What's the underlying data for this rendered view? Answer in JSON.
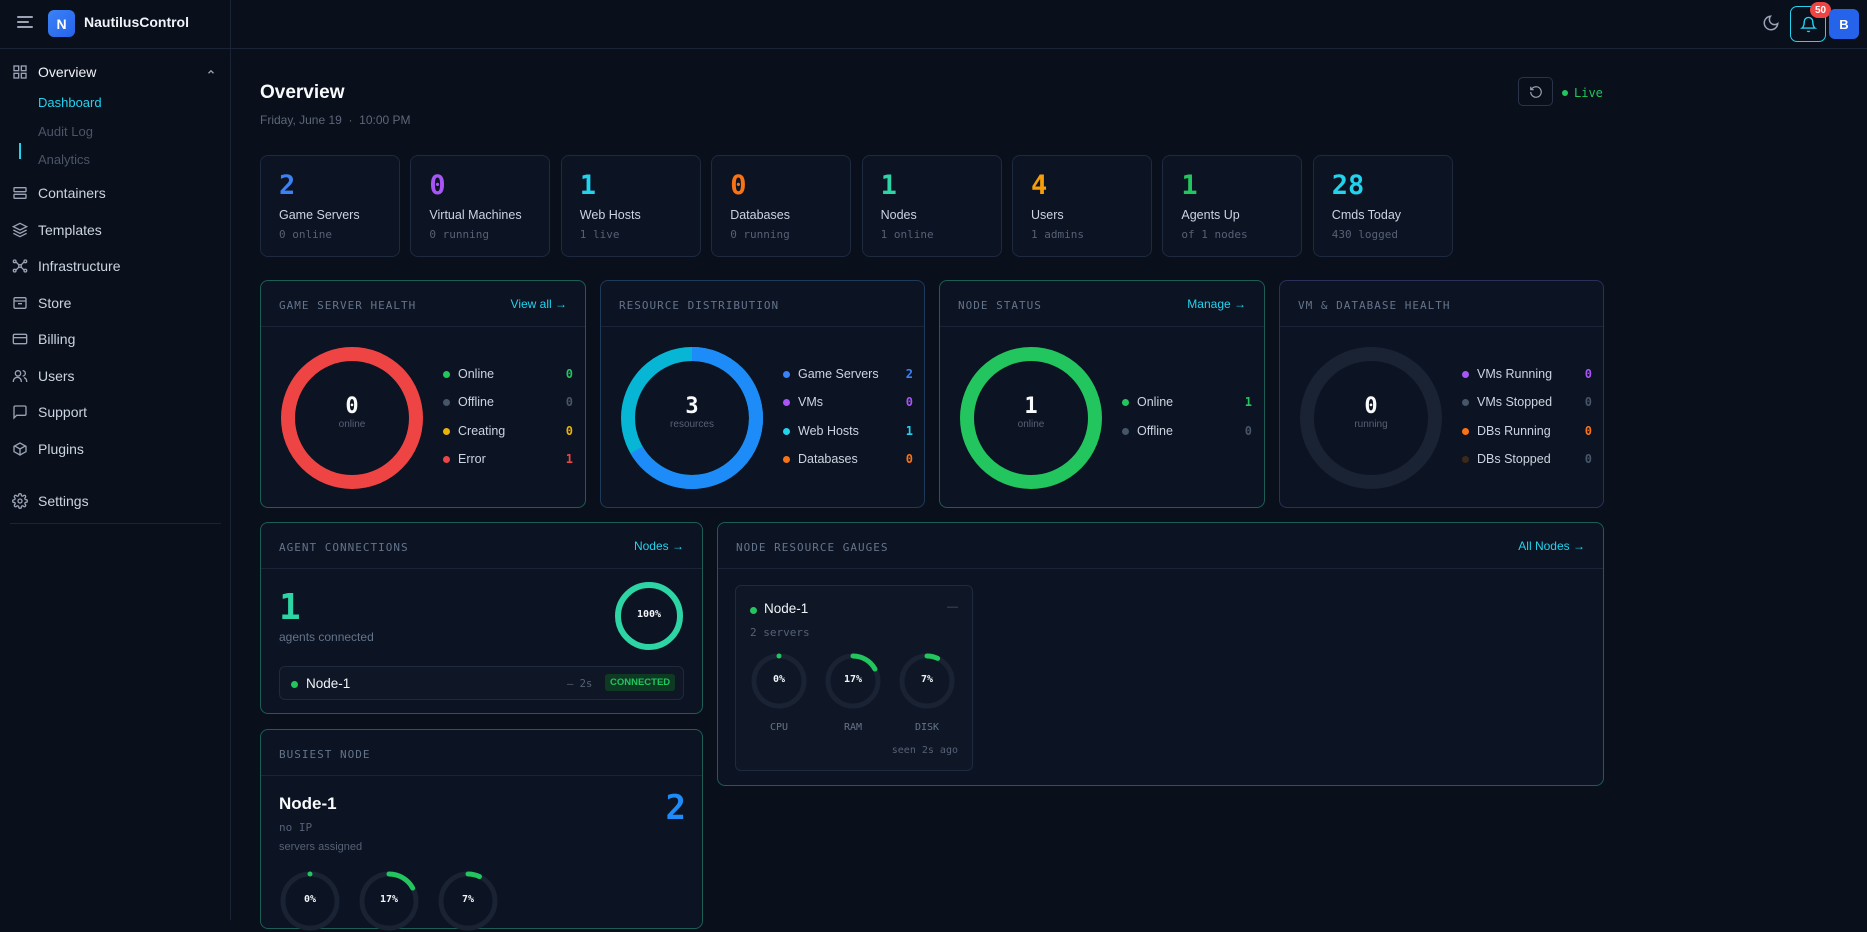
{
  "topbar": {
    "brand": "NautilusControl",
    "logo_letter": "N",
    "notification_count": "50",
    "avatar_letter": "B"
  },
  "sidebar": {
    "overview": "Overview",
    "sub_items": [
      "Dashboard",
      "Audit Log",
      "Analytics"
    ],
    "items": [
      "Containers",
      "Templates",
      "Infrastructure",
      "Store",
      "Billing",
      "Users",
      "Support",
      "Plugins"
    ],
    "settings": "Settings"
  },
  "page": {
    "title": "Overview",
    "date": "Friday, June 19",
    "time": "10:00 PM",
    "live": "Live"
  },
  "stats": [
    {
      "value": "2",
      "label": "Game Servers",
      "sub": "0 online",
      "color": "#3b82f6"
    },
    {
      "value": "0",
      "label": "Virtual Machines",
      "sub": "0 running",
      "color": "#a855f7"
    },
    {
      "value": "1",
      "label": "Web Hosts",
      "sub": "1 live",
      "color": "#22d3ee"
    },
    {
      "value": "0",
      "label": "Databases",
      "sub": "0 running",
      "color": "#f97316"
    },
    {
      "value": "1",
      "label": "Nodes",
      "sub": "1 online",
      "color": "#2dd4a4"
    },
    {
      "value": "4",
      "label": "Users",
      "sub": "1 admins",
      "color": "#f59e0b"
    },
    {
      "value": "1",
      "label": "Agents Up",
      "sub": "of 1 nodes",
      "color": "#22c55e"
    },
    {
      "value": "28",
      "label": "Cmds Today",
      "sub": "430 logged",
      "color": "#22d3ee"
    }
  ],
  "game_health": {
    "title": "GAME SERVER HEALTH",
    "link": "View all →",
    "center_value": "0",
    "center_label": "online",
    "legend": [
      {
        "label": "Online",
        "value": "0",
        "color": "#22c55e"
      },
      {
        "label": "Offline",
        "value": "0",
        "color": "#475569"
      },
      {
        "label": "Creating",
        "value": "0",
        "color": "#eab308"
      },
      {
        "label": "Error",
        "value": "1",
        "color": "#ef4444"
      }
    ]
  },
  "resource_dist": {
    "title": "RESOURCE DISTRIBUTION",
    "center_value": "3",
    "center_label": "resources",
    "legend": [
      {
        "label": "Game Servers",
        "value": "2",
        "color": "#3b82f6"
      },
      {
        "label": "VMs",
        "value": "0",
        "color": "#a855f7"
      },
      {
        "label": "Web Hosts",
        "value": "1",
        "color": "#22d3ee"
      },
      {
        "label": "Databases",
        "value": "0",
        "color": "#f97316"
      }
    ]
  },
  "node_status": {
    "title": "NODE STATUS",
    "link": "Manage →",
    "center_value": "1",
    "center_label": "online",
    "legend": [
      {
        "label": "Online",
        "value": "1",
        "color": "#22c55e"
      },
      {
        "label": "Offline",
        "value": "0",
        "color": "#475569"
      }
    ]
  },
  "vm_db_health": {
    "title": "VM & DATABASE HEALTH",
    "center_value": "0",
    "center_label": "running",
    "legend": [
      {
        "label": "VMs Running",
        "value": "0",
        "color": "#a855f7"
      },
      {
        "label": "VMs Stopped",
        "value": "0",
        "color": "#475569"
      },
      {
        "label": "DBs Running",
        "value": "0",
        "color": "#f97316"
      },
      {
        "label": "DBs Stopped",
        "value": "0",
        "color": "#3b2a1a"
      }
    ]
  },
  "agents": {
    "title": "AGENT CONNECTIONS",
    "link": "Nodes →",
    "count": "1",
    "count_label": "agents connected",
    "ring_label": "100%",
    "ring_fraction": 1.0,
    "node_name": "Node-1",
    "node_age": "— 2s",
    "node_status": "CONNECTED"
  },
  "busiest": {
    "title": "BUSIEST NODE",
    "node": "Node-1",
    "ip": "no IP",
    "servers_label": "servers assigned",
    "servers": "2",
    "gauges": [
      {
        "label": "0%",
        "fraction": 0.0
      },
      {
        "label": "17%",
        "fraction": 0.17
      },
      {
        "label": "7%",
        "fraction": 0.07
      }
    ]
  },
  "gauges_card": {
    "title": "NODE RESOURCE GAUGES",
    "link": "All Nodes →",
    "node": "Node-1",
    "dash": "—",
    "servers": "2 servers",
    "seen": "seen 2s ago",
    "gauges": [
      {
        "label": "0%",
        "name": "CPU",
        "fraction": 0.0
      },
      {
        "label": "17%",
        "name": "RAM",
        "fraction": 0.17
      },
      {
        "label": "7%",
        "name": "DISK",
        "fraction": 0.07
      }
    ]
  }
}
